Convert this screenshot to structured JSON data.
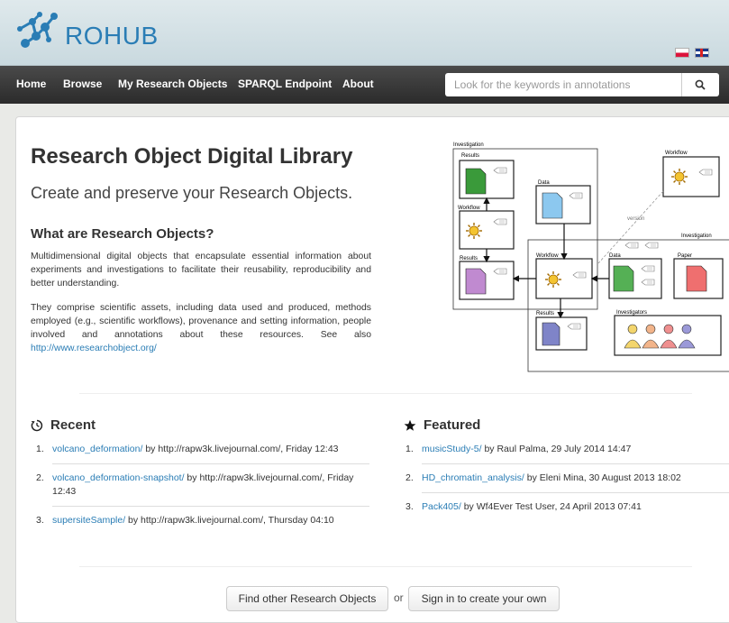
{
  "header": {
    "logo_text": "ROHUB",
    "flags": [
      "polish-flag-icon",
      "uk-flag-icon"
    ]
  },
  "nav": {
    "items": [
      "Home",
      "Browse",
      "My Research Objects",
      "SPARQL Endpoint",
      "About"
    ]
  },
  "search": {
    "placeholder": "Look for the keywords in annotations",
    "icon": "search-icon"
  },
  "main": {
    "title": "Research Object Digital Library",
    "subtitle": "Create and preserve your Research Objects.",
    "what_heading": "What are Research Objects?",
    "para1": "Multidimensional digital objects that encapsulate essential information about experiments and investigations to facilitate their reusability, reproducibility and better understanding.",
    "para2": "They comprise scientific assets, including data used and produced, methods employed (e.g., scientific workflows), provenance and setting information, people involved and annotations about these resources. See also ",
    "para2_link": "http://www.researchobject.org/"
  },
  "diagram": {
    "labels": {
      "investigation_left": "Investigation",
      "results_top": "Results",
      "workflow_left": "Workflow",
      "results_left": "Results",
      "data_top": "Data",
      "workflow_right": "Workflow",
      "version": "version",
      "investigation_right": "Investigation",
      "workflow_center": "Workflow",
      "data_right": "Data",
      "paper": "Paper",
      "results_bottom": "Results",
      "investigators": "Investigators"
    }
  },
  "recent": {
    "heading": "Recent",
    "icon": "clock-icon",
    "items": [
      {
        "num": "1.",
        "link": "volcano_deformation/",
        "rest": " by http://rapw3k.livejournal.com/, Friday 12:43"
      },
      {
        "num": "2.",
        "link": "volcano_deformation-snapshot/",
        "rest": " by http://rapw3k.livejournal.com/, Friday 12:43"
      },
      {
        "num": "3.",
        "link": "supersiteSample/",
        "rest": " by http://rapw3k.livejournal.com/, Thursday 04:10"
      }
    ]
  },
  "featured": {
    "heading": "Featured",
    "icon": "star-icon",
    "items": [
      {
        "num": "1.",
        "link": "musicStudy-5/",
        "rest": " by Raul Palma, 29 July 2014 14:47"
      },
      {
        "num": "2.",
        "link": "HD_chromatin_analysis/",
        "rest": " by Eleni Mina, 30 August 2013 18:02"
      },
      {
        "num": "3.",
        "link": "Pack405/",
        "rest": " by Wf4Ever Test User, 24 April 2013 07:41"
      }
    ]
  },
  "actions": {
    "find_label": "Find other Research Objects",
    "or_label": "or",
    "signin_label": "Sign in to create your own"
  }
}
